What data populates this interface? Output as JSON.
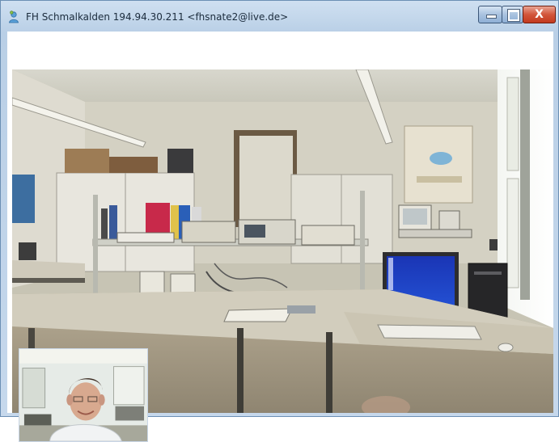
{
  "window": {
    "title": "FH Schmalkalden 194.94.30.211 <fhsnate2@live.de>",
    "close_symbol": "X"
  },
  "icons": {
    "app": "user-icon",
    "minimize": "minimize-icon",
    "maximize": "maximize-icon",
    "close": "close-icon"
  },
  "colors": {
    "title_bar": "#c6d8ec",
    "close_button": "#c33a1f",
    "content_bg": "#ffffff"
  }
}
